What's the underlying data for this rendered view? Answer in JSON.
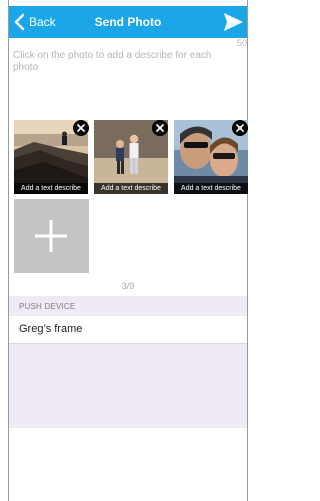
{
  "colors": {
    "accent": "#1aa6e8",
    "section_background": "#efeaf4",
    "placeholder_text": "#b6b6b6"
  },
  "navbar": {
    "back_label": "Back",
    "title": "Send Photo",
    "back_icon": "chevron-left-icon",
    "send_icon": "paper-plane-icon"
  },
  "description": {
    "counter": "50",
    "placeholder": "Click on the photo to add a describe for each photo"
  },
  "photos": [
    {
      "caption": "Add a text describe",
      "content": "person sitting on rocks by the sea"
    },
    {
      "caption": "Add a text describe",
      "content": "two children standing on a beach"
    },
    {
      "caption": "Add a text describe",
      "content": "two adults taking a selfie with sunglasses"
    }
  ],
  "add_tile": {
    "icon": "plus-icon"
  },
  "page_indicator": "3/9",
  "push_device": {
    "header": "PUSH DEVICE",
    "device_name": "Greg’s frame"
  }
}
